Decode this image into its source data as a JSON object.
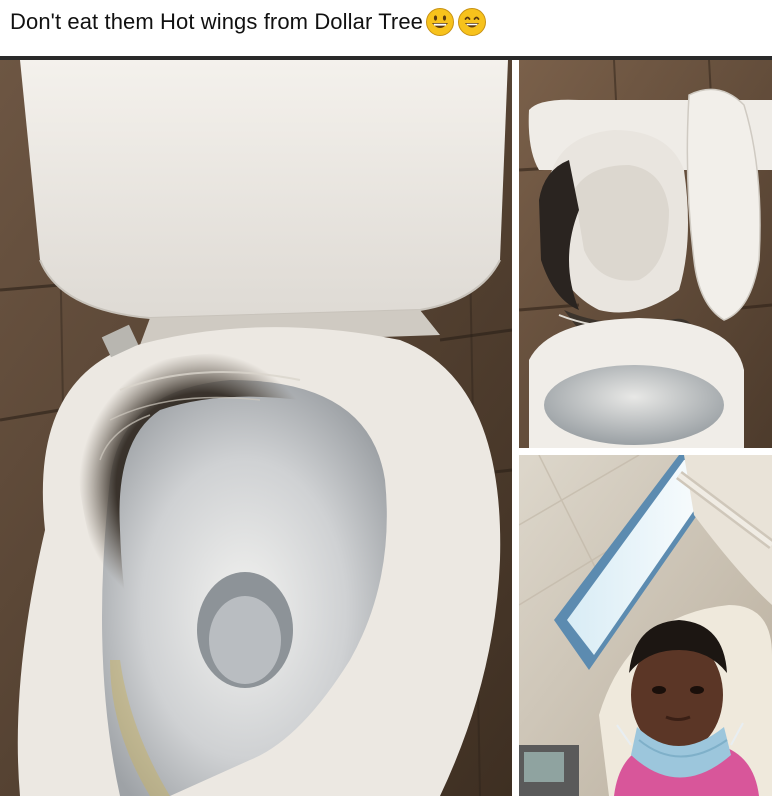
{
  "caption": {
    "text": "Don't eat them Hot wings from Dollar Tree",
    "emojis": [
      "grinning-face-emoji",
      "smiling-face-emoji"
    ]
  },
  "photos": [
    {
      "subject": "toilet-with-burnt-seat-closeup"
    },
    {
      "subject": "toilet-with-broken-melted-seat"
    },
    {
      "subject": "man-selfie-in-hospital-bed"
    }
  ],
  "colors": {
    "background": "#ffffff",
    "emoji_yellow": "#f7c21c",
    "porcelain": "#ece8e2",
    "char": "#2a2420"
  }
}
